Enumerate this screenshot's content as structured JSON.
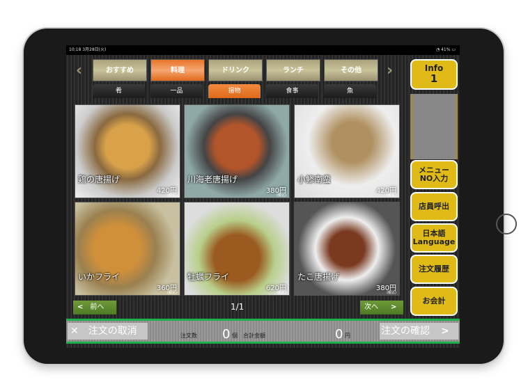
{
  "status": {
    "time": "10:18  3月28日(火)",
    "battery": "41%"
  },
  "categories": [
    {
      "label": "おすすめ",
      "active": false
    },
    {
      "label": "料理",
      "active": true
    },
    {
      "label": "ドリンク",
      "active": false
    },
    {
      "label": "ランチ",
      "active": false
    },
    {
      "label": "その他",
      "active": false
    }
  ],
  "subcategories": [
    {
      "label": "肴",
      "active": false
    },
    {
      "label": "一品",
      "active": false
    },
    {
      "label": "揚物",
      "active": true
    },
    {
      "label": "食事",
      "active": false
    },
    {
      "label": "魚",
      "active": false
    }
  ],
  "items": [
    {
      "name": "鶏の唐揚げ",
      "price": "420円",
      "tax": "(税込)"
    },
    {
      "name": "川海老唐揚げ",
      "price": "380円",
      "tax": "(税込)"
    },
    {
      "name": "小鯵南蛮",
      "price": "420円",
      "tax": "(税込)"
    },
    {
      "name": "いかフライ",
      "price": "360円",
      "tax": "(税込)"
    },
    {
      "name": "牡蠣フライ",
      "price": "620円",
      "tax": "(税込)"
    },
    {
      "name": "たこ唐揚げ",
      "price": "380円",
      "tax": "(税込)"
    }
  ],
  "pager": {
    "prev": "前へ",
    "next": "次へ",
    "page": "1/1"
  },
  "info": {
    "label": "Info",
    "count": "1"
  },
  "side": [
    {
      "label": "メニュー\nNO入力"
    },
    {
      "label": "店員呼出"
    },
    {
      "label": "日本語\nLanguage"
    },
    {
      "label": "注文履歴"
    },
    {
      "label": "お会計"
    }
  ],
  "bottom": {
    "cancel": "注文の取消",
    "count_label": "注文数",
    "count": "0",
    "count_unit": "個",
    "total_label": "合計金額",
    "total": "0",
    "total_unit": "円",
    "confirm": "注文の確認"
  },
  "colors": {
    "accent": "#e8742a",
    "gold": "#e0bb18",
    "green": "#1db14c"
  }
}
